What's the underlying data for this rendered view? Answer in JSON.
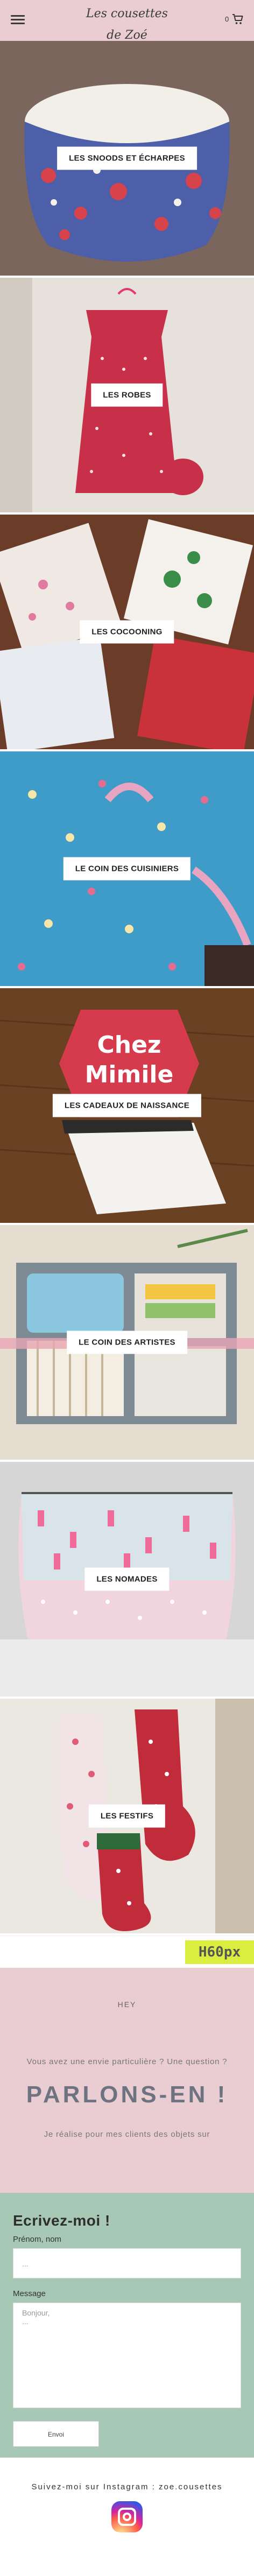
{
  "header": {
    "logo_text": "Les cousettes de Zoé",
    "cart_count": "0"
  },
  "categories": [
    {
      "label": "LES SNOODS ET ÉCHARPES"
    },
    {
      "label": "LES ROBES"
    },
    {
      "label": "LES COCOONING"
    },
    {
      "label": "LE COIN DES CUISINIERS"
    },
    {
      "label": "LES CADEAUX DE NAISSANCE"
    },
    {
      "label": "LE COIN DES ARTISTES"
    },
    {
      "label": "LES NOMADES"
    },
    {
      "label": "LES FESTIFS"
    }
  ],
  "placeholder_badge": "H60px",
  "contact_intro": {
    "hey": "HEY",
    "question": "Vous avez une envie particulière ? Une question ?",
    "headline": "PARLONS-EN !",
    "subtext": "Je réalise pour mes clients des objets sur"
  },
  "form": {
    "title": "Ecrivez-moi !",
    "name_label": "Prénom, nom",
    "name_placeholder": "...",
    "message_label": "Message",
    "message_placeholder": "Bonjour,",
    "message_placeholder_2": "...",
    "send_label": "Envoi"
  },
  "footer": {
    "follow_text": "Suivez-moi sur Instagram : zoe.cousettes"
  },
  "colors": {
    "header_bg": "#e9cdd2",
    "pink_section": "#e9cdd2",
    "green_section": "#a7c8b5",
    "badge": "#d9ee3f"
  }
}
